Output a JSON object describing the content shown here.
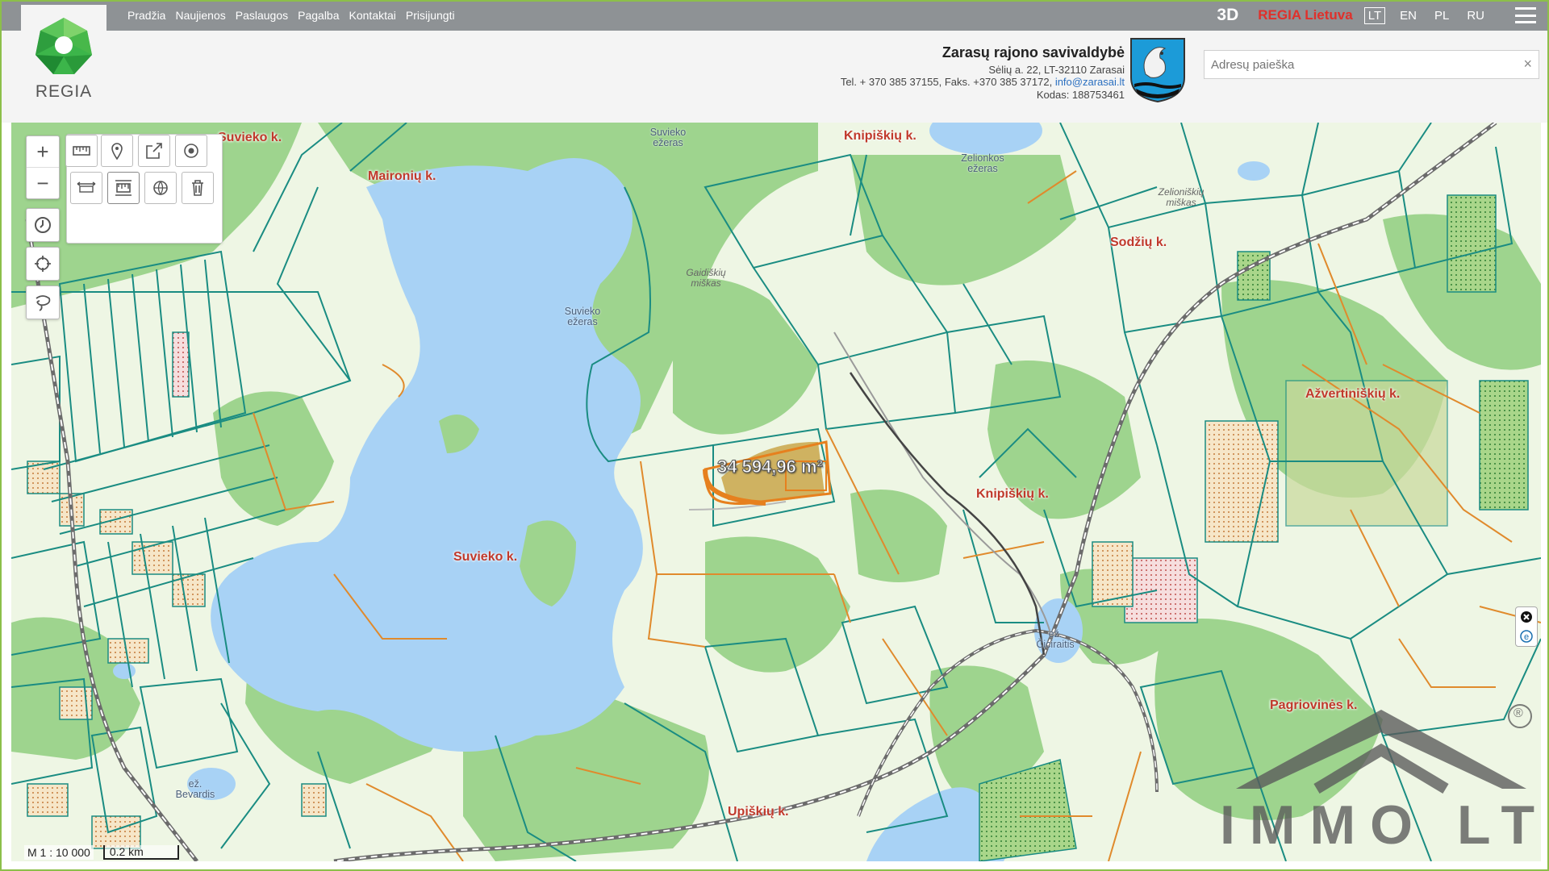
{
  "nav": {
    "items": [
      "Pradžia",
      "Naujienos",
      "Paslaugos",
      "Pagalba",
      "Kontaktai",
      "Prisijungti"
    ]
  },
  "topbar": {
    "btn_3d": "3D",
    "regia_lietuva": "REGIA Lietuva",
    "languages": [
      "LT",
      "EN",
      "PL",
      "RU"
    ],
    "active_language": "LT"
  },
  "logo": {
    "text": "REGIA"
  },
  "municipality": {
    "name": "Zarasų rajono savivaldybė",
    "address": "Sėlių a. 22, LT-32110 Zarasai",
    "phone": "Tel. + 370 385 37155, Faks. +370 385 37172,",
    "email": "info@zarasai.lt",
    "code": "Kodas: 188753461"
  },
  "search": {
    "placeholder": "Adresų paieška",
    "value": "",
    "clear_label": "×"
  },
  "map": {
    "area_label": "34 594,96 m²",
    "labels": {
      "suvieko_k_top": "Suvieko k.",
      "maironiu_k": "Maironių k.",
      "suvieko_ezeras_top": "Suvieko ežeras",
      "knipiskiu_k_top": "Knipiškių k.",
      "zeionkos_ezeras": "Zelionkos ežeras",
      "zeioniskiu_miskas": "Zelioniškių miškas",
      "sodziu_k": "Sodžių k.",
      "gaidiskiu_miskas": "Gaidiškių miškas",
      "suvieko_ezeras": "Suvieko ežeras",
      "azvertiniskiu_k": "Ažvertiniškių k.",
      "knipiskiu_k": "Knipiškių k.",
      "suvieko_k": "Suvieko k.",
      "ez_ciciraitis": "ež. Čiciraitis",
      "pagrioviniu_k": "Pagriovinės k.",
      "ez_bevardis": "ež. Bevardis",
      "upiskiu_k": "Upiškių k."
    },
    "scale_ratio": "M 1 : 10 000",
    "scale_bar": "0.2 km"
  },
  "watermark": {
    "text": "IMMO LT",
    "registered": "®"
  },
  "colors": {
    "forest": "#9ed48e",
    "field": "#eef6e4",
    "water": "#a8d2f5",
    "parcel_teal": "#1a8c82",
    "parcel_orange": "#e08a2c",
    "highlight": "#e6801e",
    "rail": "#6b6b6b",
    "topbar": "#8e9295"
  }
}
